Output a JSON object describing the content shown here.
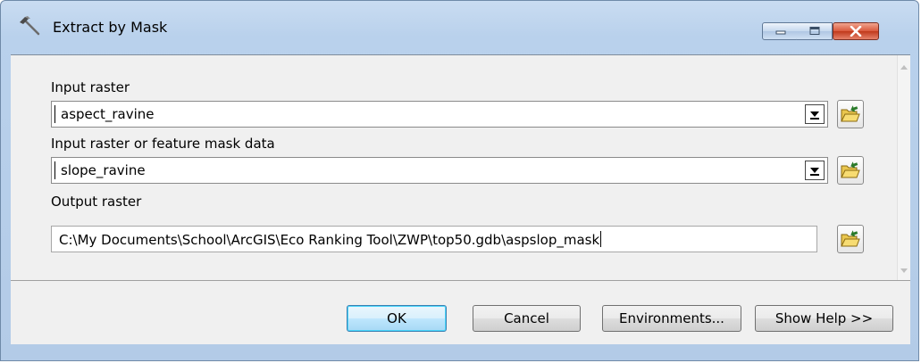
{
  "window": {
    "title": "Extract by Mask",
    "title_icon": "hammer-icon",
    "controls": {
      "minimize_icon": "minimize-icon",
      "maximize_icon": "maximize-icon",
      "close_icon": "close-icon"
    }
  },
  "form": {
    "input_raster": {
      "label": "Input raster",
      "value": "aspect_ravine",
      "browse_icon": "open-folder-icon"
    },
    "mask_data": {
      "label": "Input raster or feature mask data",
      "value": "slope_ravine",
      "browse_icon": "open-folder-icon"
    },
    "output_raster": {
      "label": "Output raster",
      "value": "C:\\My Documents\\School\\ArcGIS\\Eco Ranking Tool\\ZWP\\top50.gdb\\aspslop_mask",
      "browse_icon": "open-folder-icon"
    }
  },
  "buttons": {
    "ok": "OK",
    "cancel": "Cancel",
    "environments": "Environments...",
    "show_help": "Show Help >>"
  },
  "colors": {
    "title_bar": "#b9d1ec",
    "close_button": "#c1391b",
    "client_bg": "#f0f0f0",
    "default_button": "#bee6fd"
  }
}
